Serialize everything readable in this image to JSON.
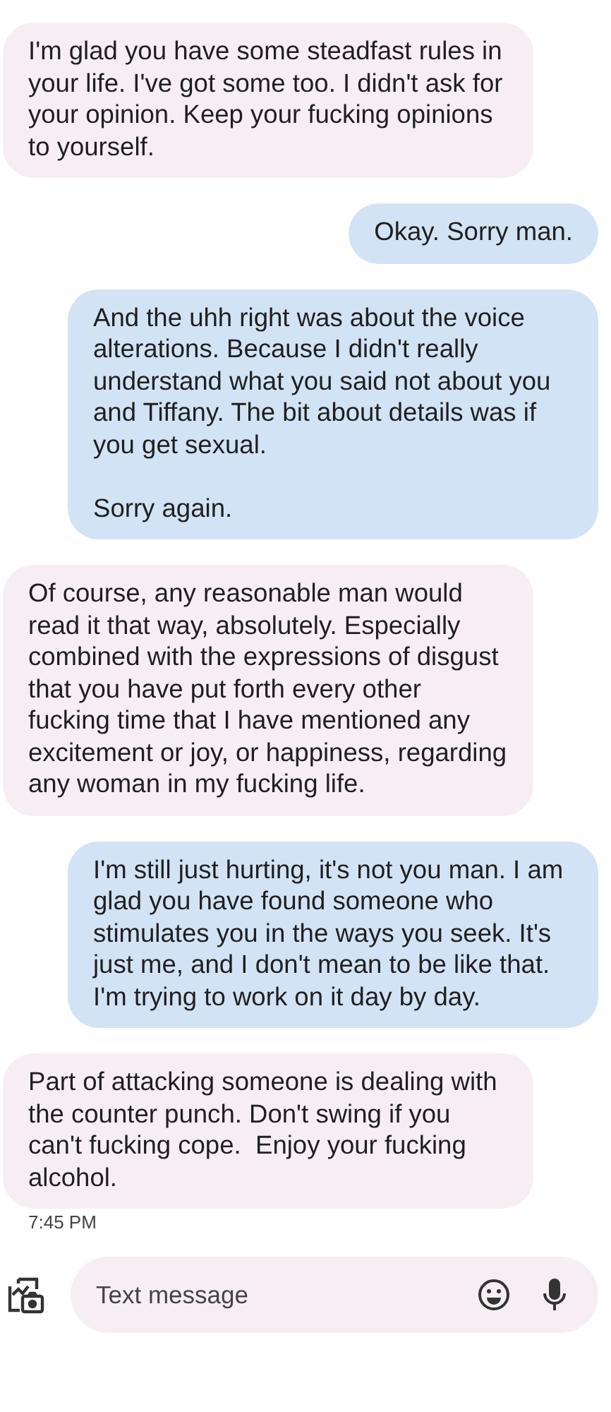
{
  "messages": [
    {
      "kind": "incoming",
      "text": "I'm glad you have some steadfast rules in your life. I've got some too. I didn't ask for your opinion. Keep your fucking opinions to yourself."
    },
    {
      "kind": "outgoing",
      "text": "Okay. Sorry man."
    },
    {
      "kind": "outgoing",
      "text": "And the uhh right was about the voice alterations. Because I didn't really understand what you said not about you and Tiffany. The bit about details was if you get sexual.\n\nSorry again."
    },
    {
      "kind": "incoming",
      "text": "Of course, any reasonable man would read it that way, absolutely. Especially combined with the expressions of disgust that you have put forth every other fucking time that I have mentioned any excitement or joy, or happiness, regarding any woman in my fucking life."
    },
    {
      "kind": "outgoing",
      "text": "I'm still just hurting, it's not you man. I am glad you have found someone who stimulates you in the ways you seek. It's just me, and I don't mean to be like that. I'm trying to work on it day by day."
    },
    {
      "kind": "incoming",
      "text": "Part of attacking someone is dealing with the counter punch. Don't swing if you can't fucking cope.  Enjoy your fucking alcohol."
    }
  ],
  "timestamp": "7:45 PM",
  "composer": {
    "placeholder": "Text message"
  }
}
